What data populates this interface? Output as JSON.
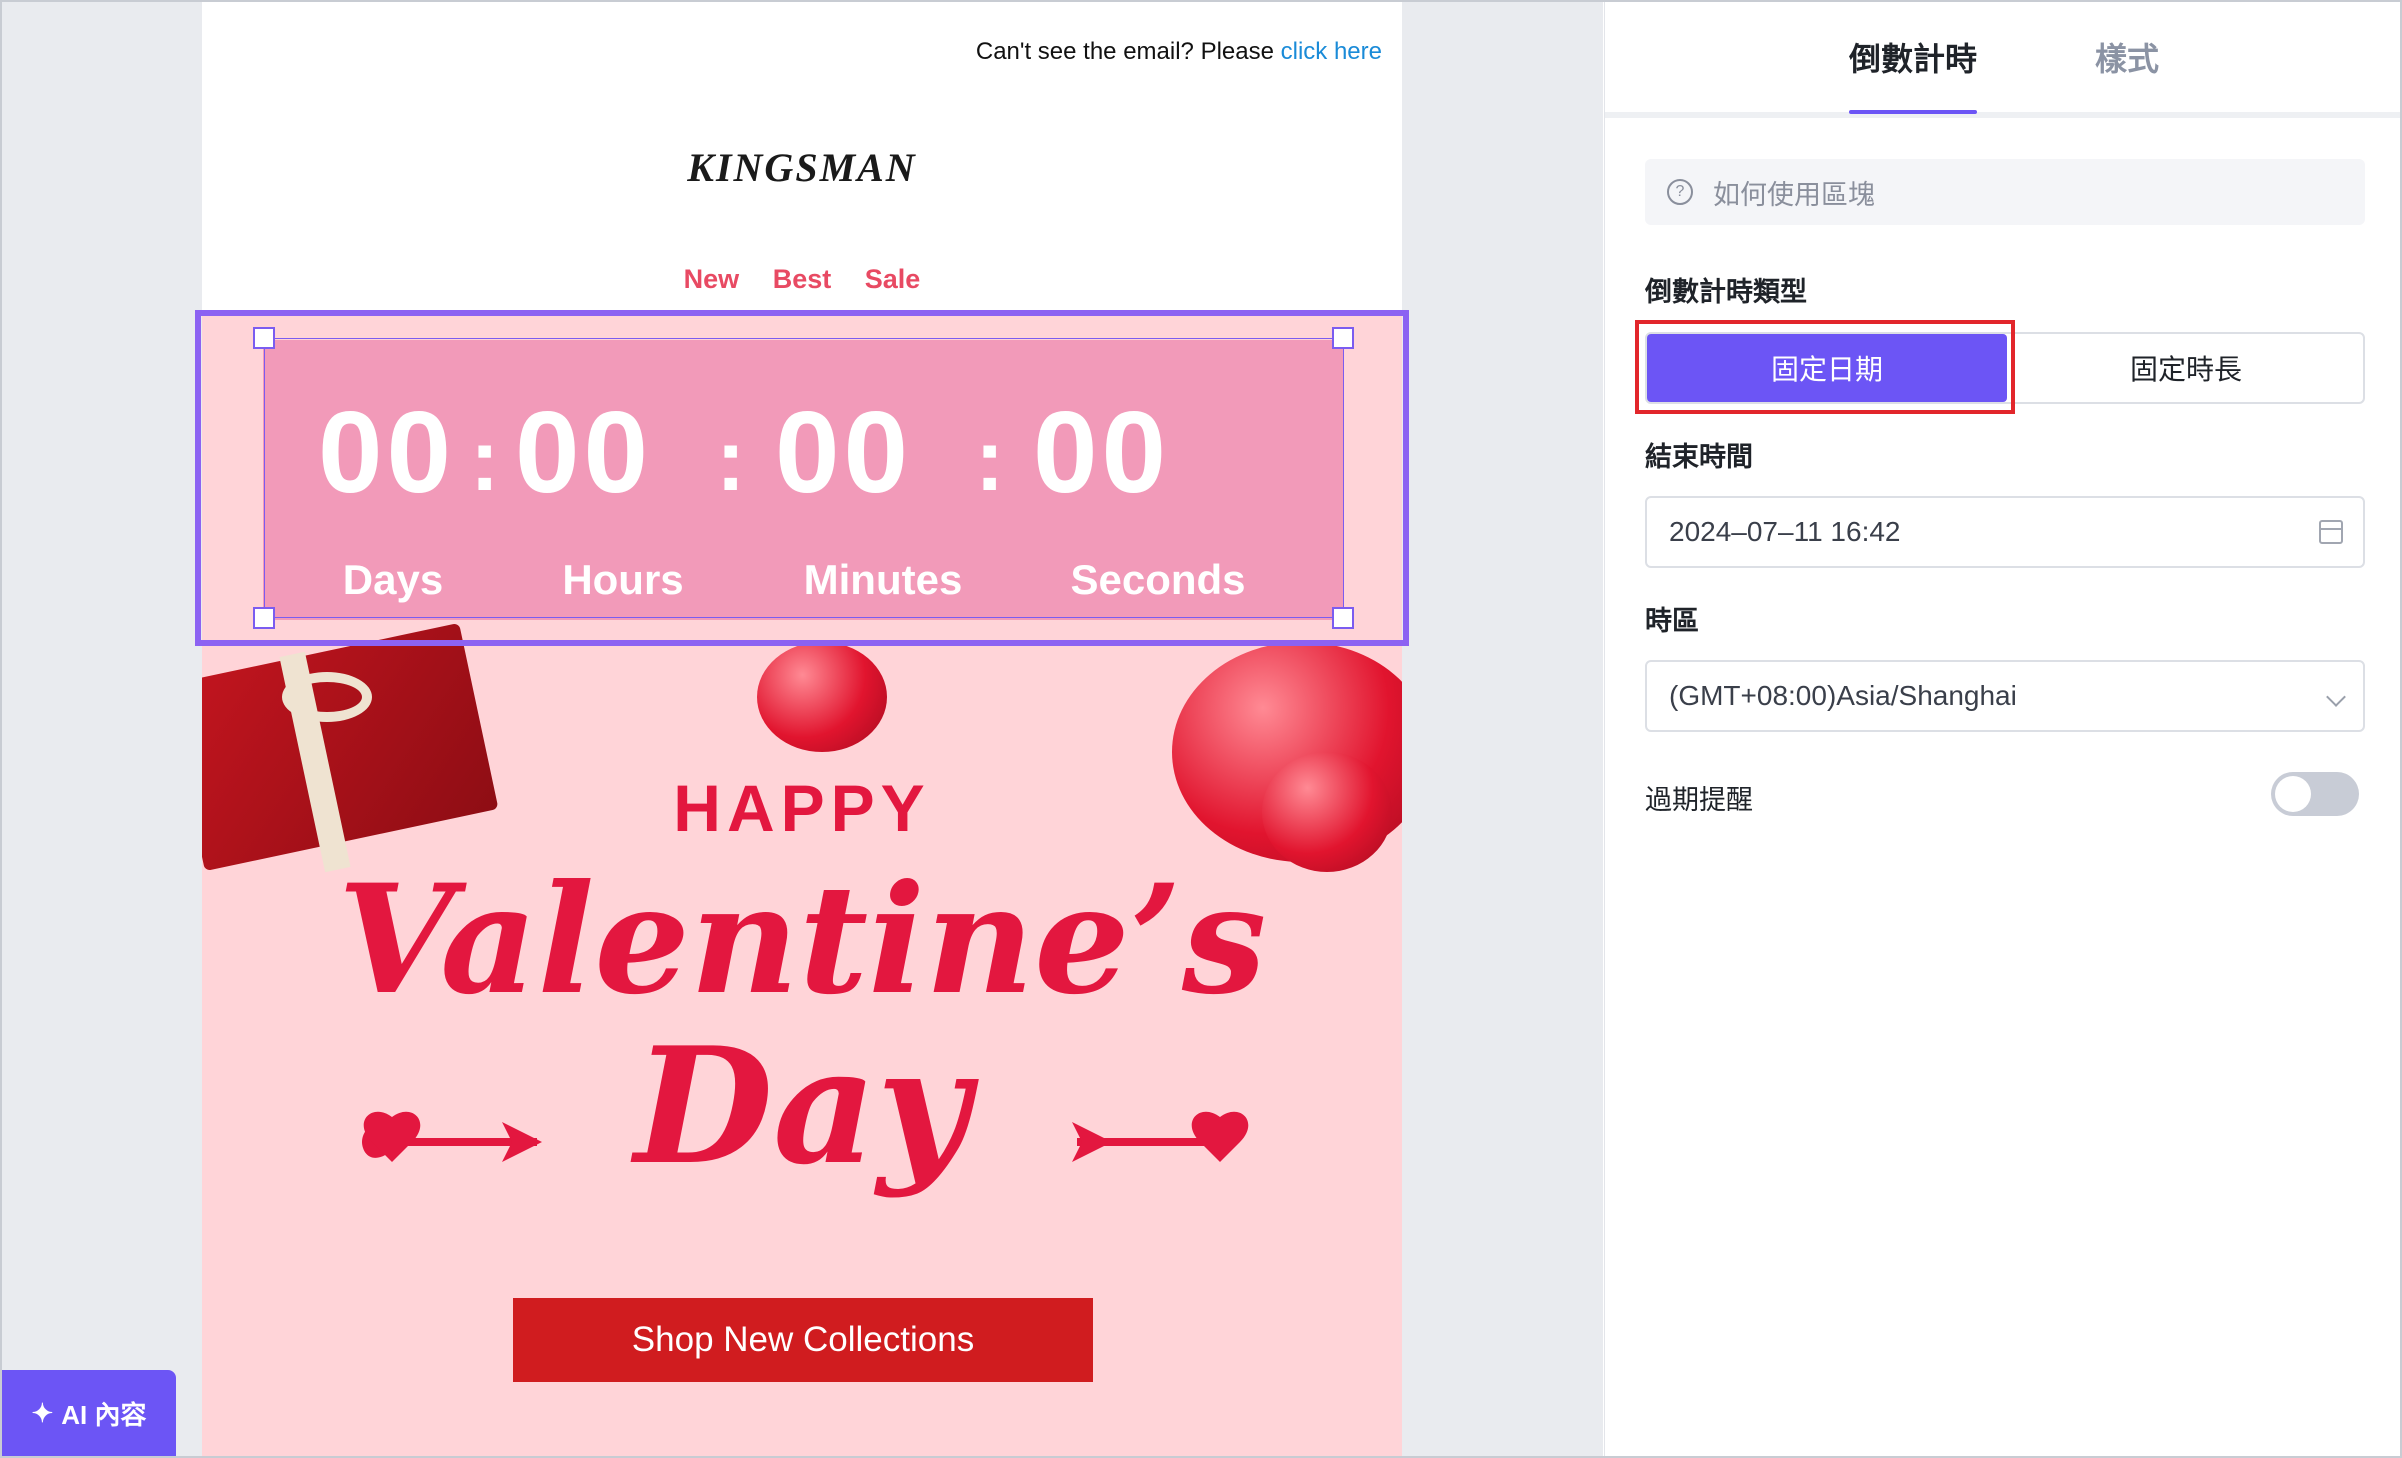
{
  "email": {
    "topline_text": "Can't see the email? Please",
    "topline_link": "click here",
    "brand": "KINGSMAN",
    "nav": [
      "New",
      "Best",
      "Sale"
    ],
    "countdown": {
      "days": "00",
      "hours": "00",
      "minutes": "00",
      "seconds": "00",
      "separator": ":",
      "labels": {
        "days": "Days",
        "hours": "Hours",
        "minutes": "Minutes",
        "seconds": "Seconds"
      }
    },
    "hero": {
      "happy": "HAPPY",
      "title_line1": "Valentine’s",
      "title_line2": "Day",
      "cta": "Shop New Collections"
    }
  },
  "ai_button": {
    "label": "AI 內容",
    "icon": "sparkle-icon"
  },
  "panel": {
    "tabs": [
      {
        "label": "倒數計時",
        "active": true
      },
      {
        "label": "樣式",
        "active": false
      }
    ],
    "help": "如何使用區塊",
    "type_label": "倒數計時類型",
    "type_options": [
      "固定日期",
      "固定時長"
    ],
    "type_selected": "固定日期",
    "end_time_label": "結束時間",
    "end_time_value": "2024–07–11 16:42",
    "timezone_label": "時區",
    "timezone_value": "(GMT+08:00)Asia/Shanghai",
    "expiry_label": "過期提醒",
    "expiry_enabled": false
  },
  "colors": {
    "accent": "#6c55f5",
    "countdown_bg": "#f29ab9",
    "hero_bg": "#ffd4d8",
    "cta_bg": "#d01c1f",
    "nav_color": "#e84a63",
    "highlight_border": "#e2262b"
  }
}
